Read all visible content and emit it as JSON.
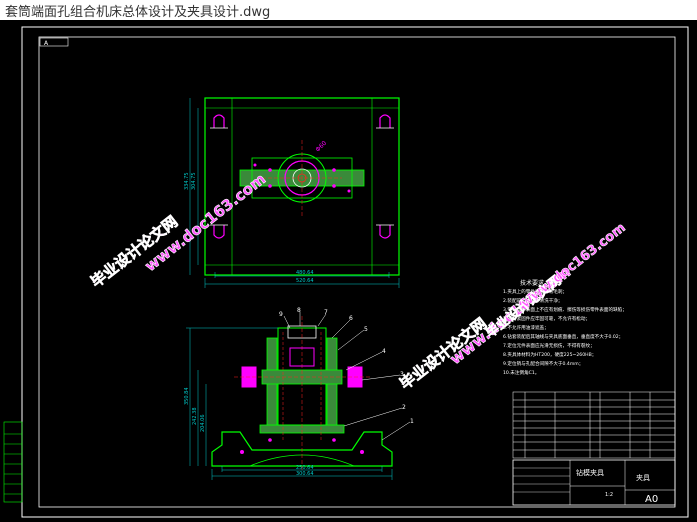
{
  "window": {
    "title": "套筒端面孔组合机床总体设计及夹具设计.dwg"
  },
  "colors": {
    "background": "#000000",
    "frame": "#ffffff",
    "outline": "#00ff00",
    "fill": "#3a8a3a",
    "hidden": "#ff2020",
    "part": "#ff00ff",
    "dim": "#00cccc",
    "text": "#ffffff"
  },
  "drawing": {
    "top_corner_label": "A",
    "top_view": {
      "dim_w1": "480.64",
      "dim_w2": "520.64",
      "dim_h1": "304.75",
      "dim_h2": "334.75"
    },
    "front_view": {
      "callouts": [
        "9",
        "8",
        "7",
        "6",
        "5",
        "4",
        "3",
        "2",
        "1"
      ],
      "dim_w1": "250.64",
      "dim_w2": "300.64",
      "dim_h1": "350.84",
      "dim_h2": "242.38",
      "dim_h3": "204.06"
    },
    "notes": {
      "heading": "技术要求",
      "lines": [
        "1.夹具上的零件不允许有毛刺；",
        "2.装配前应将零件清洗干净；",
        "3.零件加工表面上不应有划痕、擦伤等损伤零件表面的缺陷；",
        "4.所有紧固件应牢固可靠，不允许有松动；",
        "5.不允许用油漆遮盖；",
        "6.钻套装配后其轴线与夹具底面垂直，垂直度不大于0.02；",
        "7.定位元件表面应光滑无损伤，不得有裂纹；",
        "8.夹具体材料为HT200，硬度225~260HB；",
        "9.定位销与孔配合间隙不大于0.4mm；",
        "10.未注倒角C1。"
      ]
    },
    "title_block": {
      "name": "钻模夹具",
      "drawing_no": "夹具",
      "sheet_size": "A0",
      "scale": "1:2"
    },
    "watermarks": [
      "毕业设计论文网",
      "www.doc163.com",
      "毕业设计论文网",
      "www.doc163.com",
      "毕业设计论文网",
      "www.doc163.com"
    ]
  }
}
